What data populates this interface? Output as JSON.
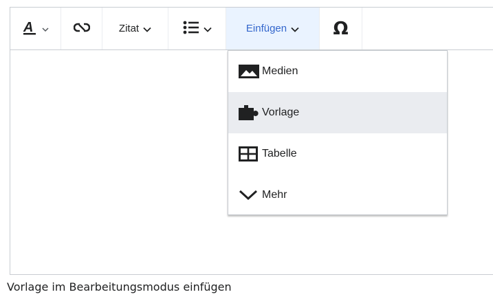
{
  "toolbar": {
    "cite_label": "Zitat",
    "insert_label": "Einfügen",
    "special_char_label": "Ω"
  },
  "insert_menu": {
    "items": [
      {
        "label": "Medien",
        "icon": "image-icon"
      },
      {
        "label": "Vorlage",
        "icon": "puzzle-icon"
      },
      {
        "label": "Tabelle",
        "icon": "table-icon"
      },
      {
        "label": "Mehr",
        "icon": "chevron-down-icon"
      }
    ]
  },
  "caption": "Vorlage im Bearbeitungsmodus einfügen",
  "colors": {
    "accent": "#3366cc",
    "active_bg": "#eaf3ff",
    "hover_bg": "#eaecf0",
    "border": "#c8ccd1"
  }
}
